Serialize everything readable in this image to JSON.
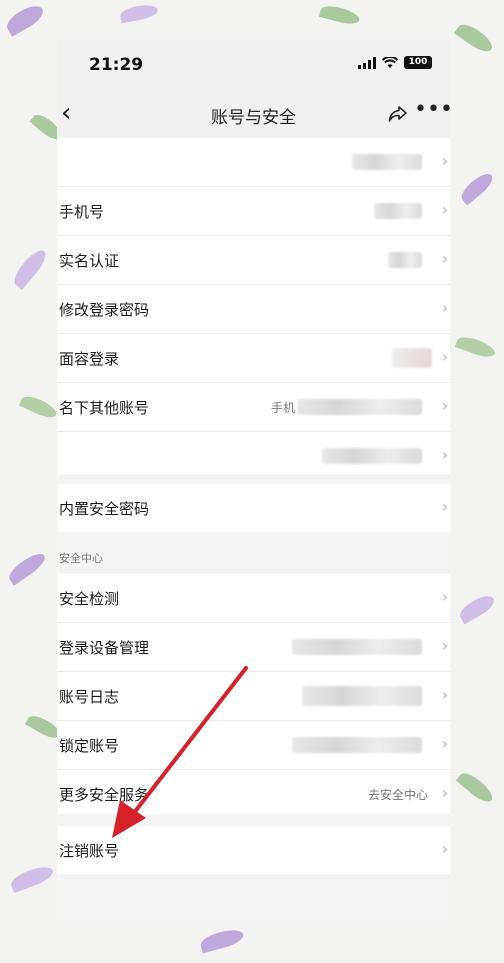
{
  "status": {
    "time": "21:29",
    "battery": "100"
  },
  "nav": {
    "title": "账号与安全"
  },
  "account_items": [
    {
      "label": ""
    },
    {
      "label": "手机号"
    },
    {
      "label": "实名认证"
    },
    {
      "label": "修改登录密码"
    },
    {
      "label": "面容登录"
    },
    {
      "label": "名下其他账号",
      "value": "手机"
    },
    {
      "label": ""
    }
  ],
  "security_password": {
    "label": "内置安全密码"
  },
  "security_center": {
    "header": "安全中心",
    "items": [
      {
        "label": "安全检测"
      },
      {
        "label": "登录设备管理"
      },
      {
        "label": "账号日志"
      },
      {
        "label": "锁定账号"
      },
      {
        "label": "更多安全服务",
        "value": "去安全中心"
      }
    ]
  },
  "cancel_account": {
    "label": "注销账号"
  },
  "colors": {
    "annotation_arrow": "#d6202a",
    "leaf_purple": "#b49ad8",
    "leaf_green": "#9cbf8f"
  }
}
